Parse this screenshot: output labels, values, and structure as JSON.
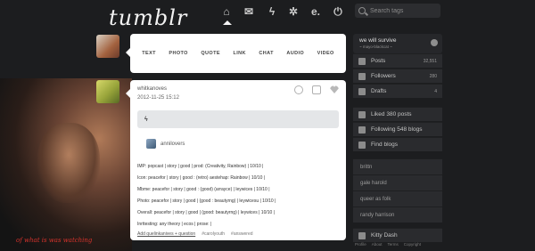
{
  "header": {
    "logo": "tumblr",
    "nav": [
      {
        "name": "dashboard",
        "icon": "house-icon",
        "glyph": "⌂"
      },
      {
        "name": "messages",
        "icon": "mail-icon",
        "glyph": "✉"
      },
      {
        "name": "activity",
        "icon": "lightning-icon",
        "glyph": "ϟ"
      },
      {
        "name": "settings",
        "icon": "gear-icon",
        "glyph": "✲"
      },
      {
        "name": "explore",
        "icon": "explore-e-icon",
        "glyph": "e."
      },
      {
        "name": "logout",
        "icon": "power-icon",
        "glyph": "⏻"
      }
    ],
    "search_placeholder": "Search tags"
  },
  "post_types": [
    "TEXT",
    "PHOTO",
    "QUOTE",
    "LINK",
    "CHAT",
    "AUDIO",
    "VIDEO"
  ],
  "post": {
    "author": "whitkanoves",
    "date": "2012-11-25 15:12",
    "quote_mark": "ϟ",
    "reblog_name": "annilovers",
    "lines": [
      "IMP: popcast | story | good | prod: (Creativity, Rainbow) | 10/10 |",
      "Icon: peacefor | story | good : (retro) aestehap: Rainbow | 10/10 |",
      "Mbme: peacefor | story | good : (good) (arrayce) | leywices | 10/10 |",
      "Photo: peacefor | story | good | (good : beautyrng) | leywicesu | 10/10 |",
      "Overall: peacefor | story | good | (good: beautyrng) | leywices | 10/10 |",
      "Inrttesting: any theory | ecos | prose: |"
    ],
    "tags": [
      "Add quelinkanives + question",
      "#carolyouth",
      "#answered"
    ]
  },
  "sidebar": {
    "blog_name": "we will survive",
    "blog_url": "~ mayo-blackcat ~",
    "stats": [
      {
        "label": "Posts",
        "count": "32,551",
        "icon": "posts-icon"
      },
      {
        "label": "Followers",
        "count": "280",
        "icon": "followers-icon"
      },
      {
        "label": "Drafts",
        "count": "4",
        "icon": "drafts-icon"
      }
    ],
    "liked": "Liked 380 posts",
    "following": "Following 548 blogs",
    "find": "Find blogs",
    "recommended": [
      "brittn",
      "gale harold",
      "queer as folk",
      "randy harrison"
    ],
    "kitty": "Kitty Dash",
    "footer": [
      "Profile",
      "About",
      "Terms",
      "Copyright"
    ]
  },
  "collage": {
    "caption": "of what is was watching"
  }
}
